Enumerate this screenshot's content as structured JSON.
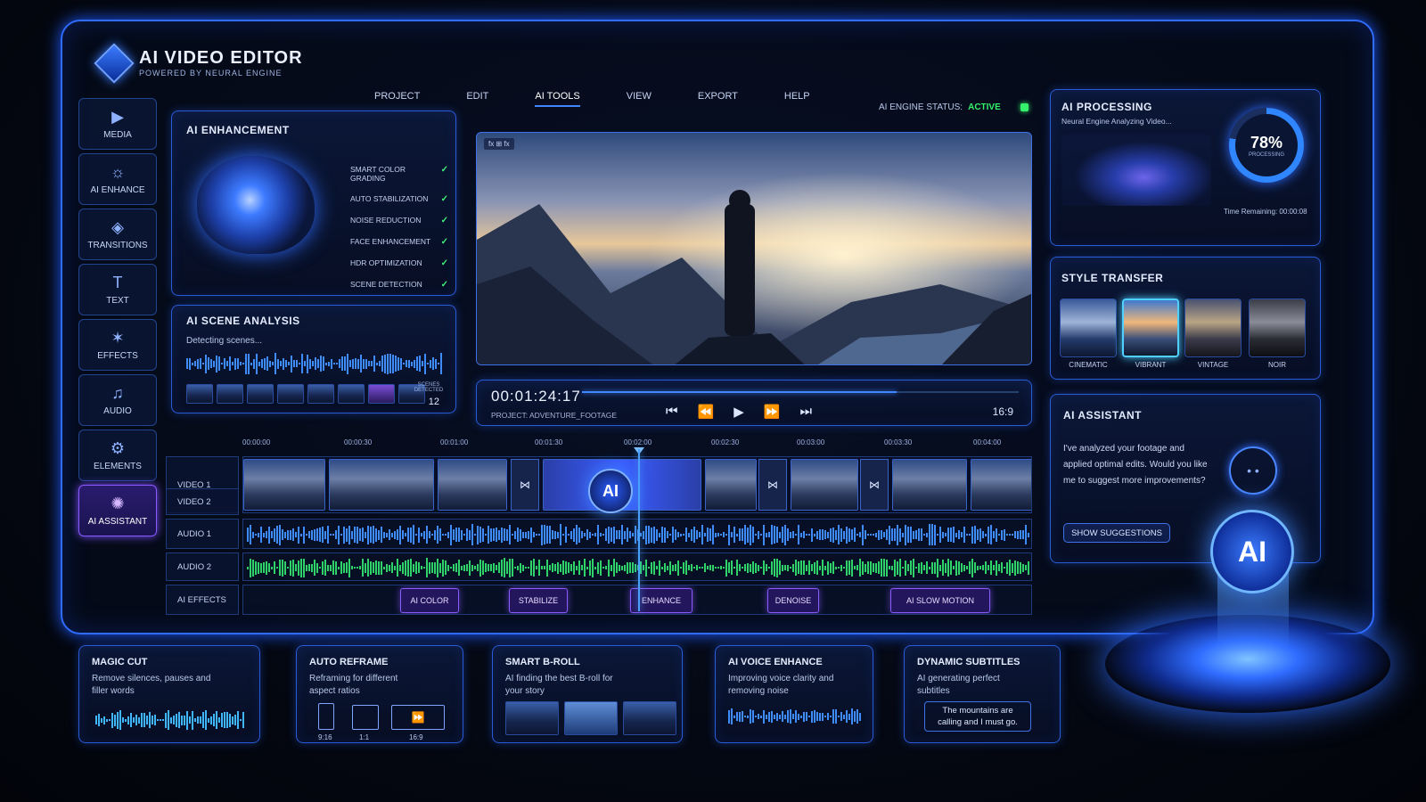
{
  "app": {
    "title": "AI VIDEO EDITOR",
    "subtitle": "POWERED BY NEURAL ENGINE"
  },
  "menu": [
    "PROJECT",
    "EDIT",
    "AI TOOLS",
    "VIEW",
    "EXPORT",
    "HELP"
  ],
  "menu_active": "AI TOOLS",
  "engine_status": {
    "label": "AI ENGINE STATUS:",
    "value": "ACTIVE"
  },
  "sidebar": [
    {
      "label": "MEDIA",
      "icon": "media-icon"
    },
    {
      "label": "AI ENHANCE",
      "icon": "sun-enhance-icon"
    },
    {
      "label": "TRANSITIONS",
      "icon": "transitions-icon"
    },
    {
      "label": "TEXT",
      "icon": "text-icon"
    },
    {
      "label": "EFFECTS",
      "icon": "sparkle-icon"
    },
    {
      "label": "AUDIO",
      "icon": "music-note-icon"
    },
    {
      "label": "ELEMENTS",
      "icon": "elements-icon"
    },
    {
      "label": "AI ASSISTANT",
      "icon": "assistant-icon"
    }
  ],
  "ai_enhancement": {
    "title": "AI ENHANCEMENT",
    "features": [
      "SMART COLOR GRADING",
      "AUTO STABILIZATION",
      "NOISE REDUCTION",
      "FACE ENHANCEMENT",
      "HDR OPTIMIZATION",
      "SCENE DETECTION"
    ]
  },
  "scene_analysis": {
    "title": "AI SCENE ANALYSIS",
    "status": "Detecting scenes...",
    "detected_label": "SCENES DETECTED",
    "detected_count": "12"
  },
  "preview": {
    "timecode": "00:01:24:17",
    "project": "PROJECT: ADVENTURE_FOOTAGE",
    "aspect": "16:9",
    "progress": 0.72
  },
  "timeline": {
    "ruler": [
      "00:00:00",
      "00:00:30",
      "00:01:00",
      "00:01:30",
      "00:02:00",
      "00:02:30",
      "00:03:00",
      "00:03:30",
      "00:04:00"
    ],
    "tracks": [
      "VIDEO 1",
      "VIDEO 2",
      "AUDIO 1",
      "AUDIO 2",
      "AI EFFECTS"
    ],
    "ai_badge": "AI",
    "effects": [
      "AI COLOR",
      "STABILIZE",
      "ENHANCE",
      "DENOISE",
      "AI SLOW MOTION"
    ]
  },
  "processing": {
    "title": "AI PROCESSING",
    "subtitle": "Neural Engine Analyzing Video...",
    "percent": "78%",
    "percent_label": "PROCESSING",
    "time_remaining": "Time Remaining: 00:00:08"
  },
  "style_transfer": {
    "title": "STYLE TRANSFER",
    "styles": [
      "CINEMATIC",
      "VIBRANT",
      "VINTAGE",
      "NOIR"
    ],
    "selected": "VIBRANT"
  },
  "assistant": {
    "title": "AI ASSISTANT",
    "message": "I've analyzed your footage and applied optimal edits. Would you like me to suggest more improvements?",
    "button": "SHOW SUGGESTIONS",
    "hologram": "AI"
  },
  "cards": [
    {
      "title": "MAGIC CUT",
      "desc": "Remove silences, pauses and filler words"
    },
    {
      "title": "AUTO REFRAME",
      "desc": "Reframing for different aspect ratios",
      "ratios": [
        "9:16",
        "1:1",
        "16:9"
      ]
    },
    {
      "title": "SMART B-ROLL",
      "desc": "AI finding the best B-roll for your story"
    },
    {
      "title": "AI VOICE ENHANCE",
      "desc": "Improving voice clarity and removing noise"
    },
    {
      "title": "DYNAMIC SUBTITLES",
      "desc": "AI generating perfect subtitles",
      "subtitle_sample": "The mountains are calling and I must go."
    }
  ],
  "colors": {
    "accent": "#2f6cff",
    "active_green": "#35f06b",
    "purple": "#8a5cff",
    "audio1": "#3f8cff",
    "audio2": "#2fd36a"
  }
}
